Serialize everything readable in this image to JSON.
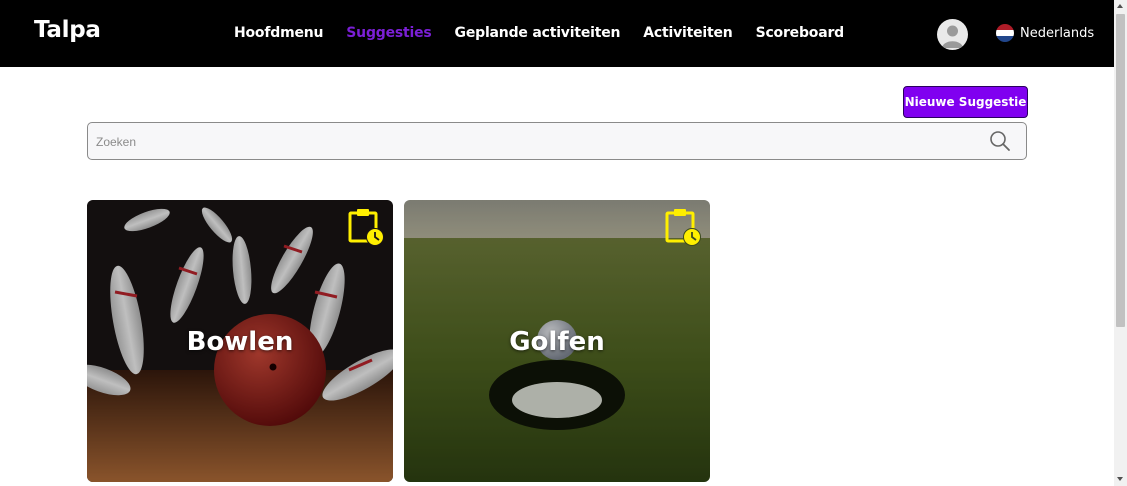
{
  "brand": "Talpa",
  "nav": {
    "items": [
      {
        "label": "Hoofdmenu",
        "active": false
      },
      {
        "label": "Suggesties",
        "active": true
      },
      {
        "label": "Geplande activiteiten",
        "active": false
      },
      {
        "label": "Activiteiten",
        "active": false
      },
      {
        "label": "Scoreboard",
        "active": false
      }
    ],
    "language": "Nederlands"
  },
  "new_suggestion_button": "Nieuwe Suggestie",
  "search": {
    "placeholder": "Zoeken",
    "value": ""
  },
  "cards": [
    {
      "title": "Bowlen",
      "icon": "clipboard-clock-icon"
    },
    {
      "title": "Golfen",
      "icon": "clipboard-clock-icon"
    }
  ],
  "colors": {
    "accent": "#8000f0",
    "active_link": "#7b1fd6",
    "navbar": "#000000",
    "card_icon": "#ffef00"
  }
}
